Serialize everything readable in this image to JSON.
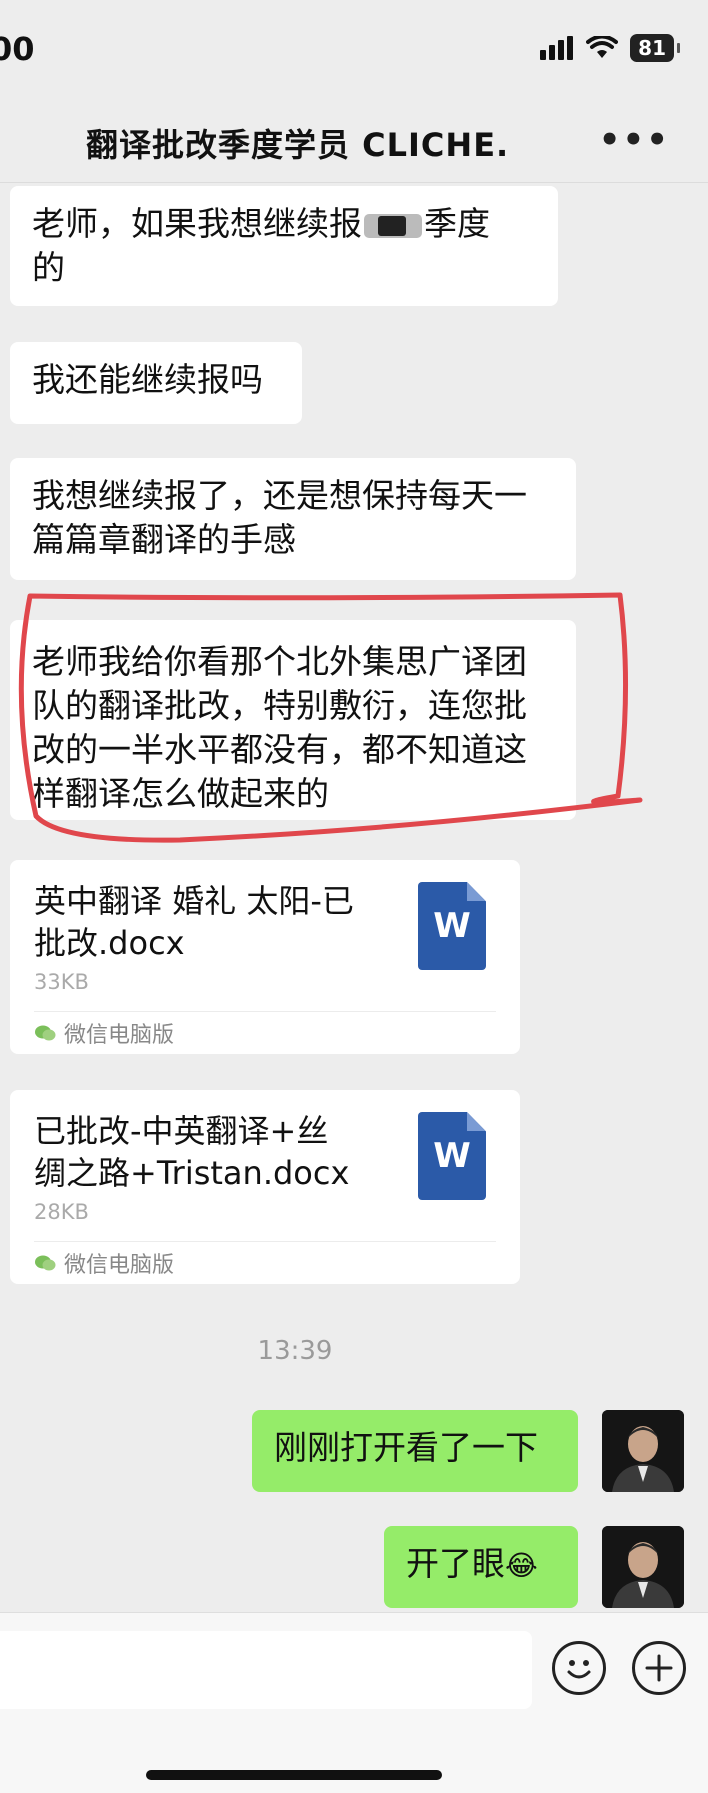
{
  "status_bar": {
    "time": "00",
    "battery": "81"
  },
  "header": {
    "title": "翻译批改季度学员 CLICHE.",
    "more_icon": "more-dots-icon",
    "more_label": "•••"
  },
  "messages": [
    {
      "side": "left",
      "line1": "老师，如果我想继续报",
      "line1_tail": "季度",
      "line2": "的"
    },
    {
      "side": "left",
      "text": "我还能继续报吗"
    },
    {
      "side": "left",
      "line1": "我想继续报了，还是想保持每天一",
      "line2": "篇篇章翻译的手感"
    },
    {
      "side": "left",
      "line1": "老师我给你看那个北外集思广译团",
      "line2": "队的翻译批改，特别敷衍，连您批",
      "line3": "改的一半水平都没有，都不知道这",
      "line4": "样翻译怎么做起来的"
    }
  ],
  "files": [
    {
      "name_line1": "英中翻译 婚礼 太阳-已",
      "name_line2": "批改.docx",
      "size": "33KB",
      "source": "微信电脑版",
      "icon": "word-file-icon",
      "icon_letter": "W"
    },
    {
      "name_line1": "已批改-中英翻译+丝",
      "name_line2": "绸之路+Tristan.docx",
      "size": "28KB",
      "source": "微信电脑版",
      "icon": "word-file-icon",
      "icon_letter": "W"
    }
  ],
  "timestamp": "13:39",
  "replies": [
    {
      "side": "right",
      "text": "刚刚打开看了一下"
    },
    {
      "side": "right",
      "text": "开了眼",
      "emoji": "😂"
    }
  ],
  "input_bar": {
    "emoji_icon": "emoji-icon",
    "plus_icon": "plus-icon"
  },
  "colors": {
    "background": "#ededed",
    "bubble_left": "#ffffff",
    "bubble_right": "#95ec69",
    "highlight": "#e0474c",
    "word_icon": "#2b5aa8"
  }
}
